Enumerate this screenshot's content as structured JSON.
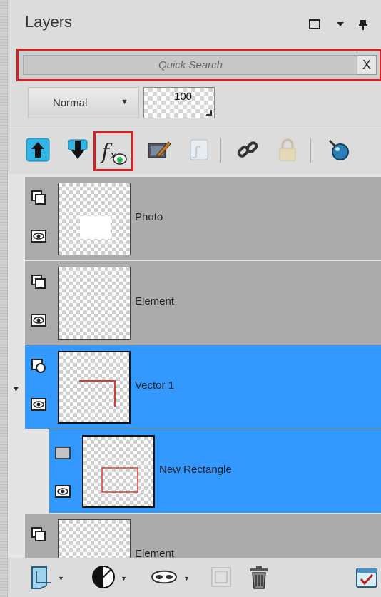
{
  "panel": {
    "title": "Layers",
    "title_buttons": [
      "maximize-icon",
      "menu-caret-icon",
      "pin-icon"
    ]
  },
  "search": {
    "placeholder": "Quick Search",
    "clear_label": "X"
  },
  "blend": {
    "mode": "Normal",
    "opacity": "100"
  },
  "toolbar": {
    "icons": [
      "move-up-icon",
      "move-down-icon",
      "layer-styles-fx-icon",
      "edit-selection-icon",
      "mask-icon",
      "link-icon",
      "lock-icon",
      "visibility-toggle-icon"
    ]
  },
  "layers": [
    {
      "name": "Photo",
      "type": "raster",
      "selected": false,
      "visible": true
    },
    {
      "name": "Element",
      "type": "raster",
      "selected": false,
      "visible": true
    },
    {
      "name": "Vector 1",
      "type": "vector-group",
      "selected": true,
      "visible": true,
      "expanded": true
    },
    {
      "name": "New Rectangle",
      "type": "shape",
      "selected": true,
      "visible": true,
      "child": true
    },
    {
      "name": "Element",
      "type": "raster",
      "selected": false,
      "visible": true
    }
  ],
  "colors": {
    "selection": "#3399ff",
    "row": "#ababab",
    "highlight": "#d42020"
  },
  "bottom_toolbar": {
    "icons": [
      "new-raster-layer-icon",
      "new-adjustment-layer-icon",
      "new-mask-icon",
      "merge-icon",
      "delete-icon",
      "properties-icon"
    ]
  }
}
